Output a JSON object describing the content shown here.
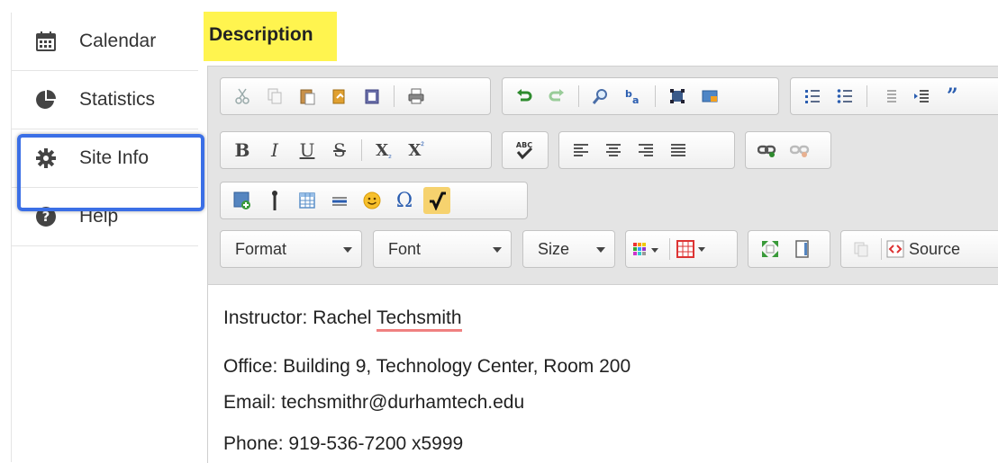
{
  "sidebar": {
    "items": [
      {
        "label": "Calendar",
        "icon": "calendar-icon"
      },
      {
        "label": "Statistics",
        "icon": "pie-chart-icon"
      },
      {
        "label": "Site Info",
        "icon": "gear-icon"
      },
      {
        "label": "Help",
        "icon": "question-circle-icon"
      }
    ]
  },
  "description": {
    "label": "Description"
  },
  "toolbar": {
    "format_label": "Format",
    "font_label": "Font",
    "size_label": "Size",
    "source_label": "Source",
    "bold": "B",
    "italic": "I",
    "underline": "U",
    "strike": "S",
    "subscript": "X",
    "superscript": "X",
    "special_char": "Ω",
    "spell": "ABC"
  },
  "content": {
    "line1_prefix": "Instructor: Rachel ",
    "line1_underlined": "Techsmith",
    "line2": "Office: Building 9, Technology Center, Room 200",
    "line3": "Email: techsmithr@durhamtech.edu",
    "line4": "Phone: 919-536-7200 x5999"
  },
  "colors": {
    "highlight_box": "#3b6fe6",
    "label_highlight": "#fff44f",
    "spell_underline": "#f08080"
  }
}
